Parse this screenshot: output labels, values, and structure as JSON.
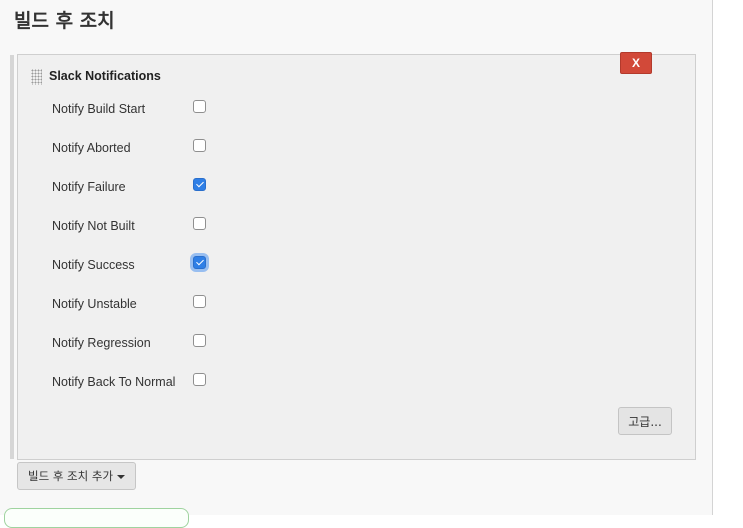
{
  "section": {
    "title": "빌드 후 조치"
  },
  "panel": {
    "title": "Slack Notifications",
    "delete_label": "X",
    "advanced_label": "고급...",
    "options": [
      {
        "label": "Notify Build Start",
        "checked": false
      },
      {
        "label": "Notify Aborted",
        "checked": false
      },
      {
        "label": "Notify Failure",
        "checked": true
      },
      {
        "label": "Notify Not Built",
        "checked": false
      },
      {
        "label": "Notify Success",
        "checked": true,
        "focused": true
      },
      {
        "label": "Notify Unstable",
        "checked": false
      },
      {
        "label": "Notify Regression",
        "checked": false
      },
      {
        "label": "Notify Back To Normal",
        "checked": false
      }
    ]
  },
  "footer": {
    "add_action_label": "빌드 후 조치 추가"
  },
  "colors": {
    "delete": "#d24939",
    "checkbox_checked": "#2f7fe6"
  },
  "icons": {
    "drag": "drag-handle-icon",
    "dropdown": "chevron-down-icon"
  }
}
